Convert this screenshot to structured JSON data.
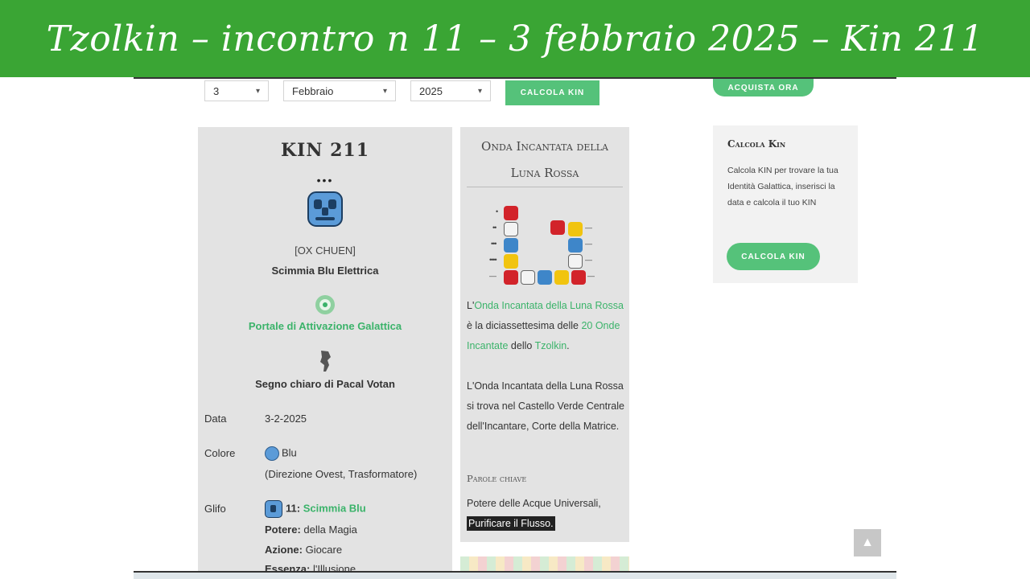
{
  "banner": {
    "title": "Tzolkin – incontro n 11 – 3 febbraio 2025 – Kin 211"
  },
  "form": {
    "day": "3",
    "month": "Febbraio",
    "year": "2025",
    "calc_button": "CALCOLA KIN"
  },
  "kin": {
    "title": "KIN 211",
    "tone_dots": "•••",
    "maya_name": "[OX CHUEN]",
    "name": "Scimmia Blu Elettrica",
    "portal": "Portale di Attivazione Galattica",
    "pacal": "Segno chiaro di Pacal Votan",
    "data_label": "Data",
    "data_value": "3-2-2025",
    "colore_label": "Colore",
    "colore_value": "Blu",
    "colore_detail": "(Direzione Ovest, Trasformatore)",
    "glifo_label": "Glifo",
    "glifo_number": "11:",
    "glifo_link": "Scimmia Blu",
    "potere_label": "Potere:",
    "potere_value": "della Magia",
    "azione_label": "Azione:",
    "azione_value": "Giocare",
    "essenza_label": "Essenza:",
    "essenza_value": "l'Illusione"
  },
  "wave": {
    "title_line1": "Onda Incantata della",
    "title_line2": "Luna Rossa",
    "p1_a": "L'",
    "p1_link1": "Onda Incantata della Luna Rossa",
    "p1_b": " è la diciassettesima delle ",
    "p1_link2": "20 Onde Incantate",
    "p1_c": " dello ",
    "p1_link3": "Tzolkin",
    "p1_d": ".",
    "p2": "L'Onda Incantata della Luna Rossa si trova nel Castello Verde Centrale dell'Incantare, Corte della Matrice.",
    "keywords_title": "Parole chiave",
    "keywords_1": "Potere delle Acque Universali,",
    "keywords_2": "Purificare il Flusso."
  },
  "sidebar": {
    "buy_button": "ACQUISTA ORA",
    "box_title": "Calcola Kin",
    "box_text": "Calcola KIN per trovare la tua Identità Galattica, inserisci la data e calcola il tuo KIN",
    "box_button": "CALCOLA KIN"
  },
  "colors": {
    "green": "#3aa534",
    "button": "#55c27a",
    "link": "#3bb36a",
    "red": "#d2232a",
    "white": "#f3f3f3",
    "blue": "#3e86c9",
    "yellow": "#f1c40f"
  },
  "icons": {
    "back_to_top": "chevron-up-icon",
    "portal": "portal-icon",
    "pacal": "pacal-votan-icon",
    "glyph": "monkey-glyph-icon"
  }
}
